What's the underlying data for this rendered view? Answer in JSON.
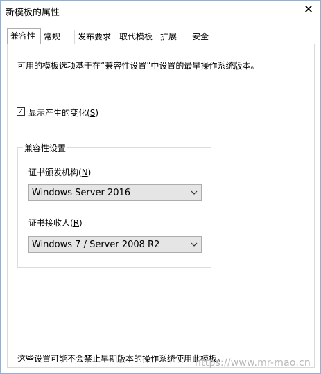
{
  "window": {
    "title": "新模板的属性",
    "close_glyph": "✕"
  },
  "tabs": [
    {
      "label": "兼容性",
      "active": true
    },
    {
      "label": "常规",
      "active": false
    },
    {
      "label": "发布要求",
      "active": false
    },
    {
      "label": "取代模板",
      "active": false
    },
    {
      "label": "扩展",
      "active": false
    },
    {
      "label": "安全",
      "active": false
    }
  ],
  "panel": {
    "description": "可用的模板选项基于在“兼容性设置”中设置的最早操作系统版本。",
    "show_changes": {
      "label_prefix": "显示产生的变化(",
      "accel": "S",
      "label_suffix": ")",
      "checked": true,
      "check_glyph": "✓"
    },
    "group": {
      "title": "兼容性设置",
      "ca": {
        "label_prefix": "证书颁发机构(",
        "accel": "N",
        "label_suffix": ")",
        "value": "Windows Server 2016"
      },
      "recipient": {
        "label_prefix": "证书接收人(",
        "accel": "R",
        "label_suffix": ")",
        "value": "Windows 7 / Server 2008 R2"
      }
    },
    "footer": "这些设置可能不会禁止早期版本的操作系统使用此模板。"
  },
  "watermark": "https://www.mr-mao.cn",
  "colors": {
    "window_border": "#8fb0d8",
    "select_bg": "#e5e5e5",
    "select_border": "#acacac"
  },
  "icons": {
    "close": "close-icon",
    "dropdown": "chevron-down-icon",
    "check": "checkmark-icon"
  }
}
